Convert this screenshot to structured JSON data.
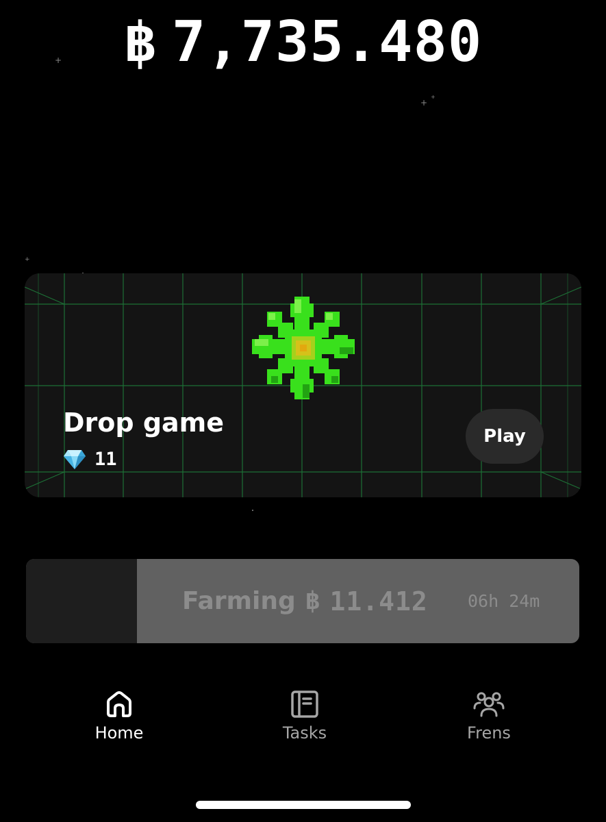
{
  "header": {
    "coin_symbol": "฿",
    "balance": "7,735.480"
  },
  "game_card": {
    "title": "Drop game",
    "gem_icon": "diamond-icon",
    "gem_count": "11",
    "play_label": "Play",
    "sprite_icon": "green-pixel-star-icon"
  },
  "farming": {
    "label": "Farming",
    "coin_symbol": "฿",
    "amount": "11.412",
    "time_left": "06h 24m",
    "progress": 0.2
  },
  "nav": {
    "items": [
      {
        "label": "Home",
        "icon": "home-icon",
        "active": true
      },
      {
        "label": "Tasks",
        "icon": "tasks-icon",
        "active": false
      },
      {
        "label": "Frens",
        "icon": "frens-icon",
        "active": false
      }
    ]
  },
  "colors": {
    "background": "#000000",
    "card": "#141414",
    "grid_line": "#1f7a3a",
    "sprite_green": "#39e01c",
    "farming_fill": "#616161",
    "farming_track": "#1e1e1e",
    "text_muted": "#8c8c8c"
  }
}
